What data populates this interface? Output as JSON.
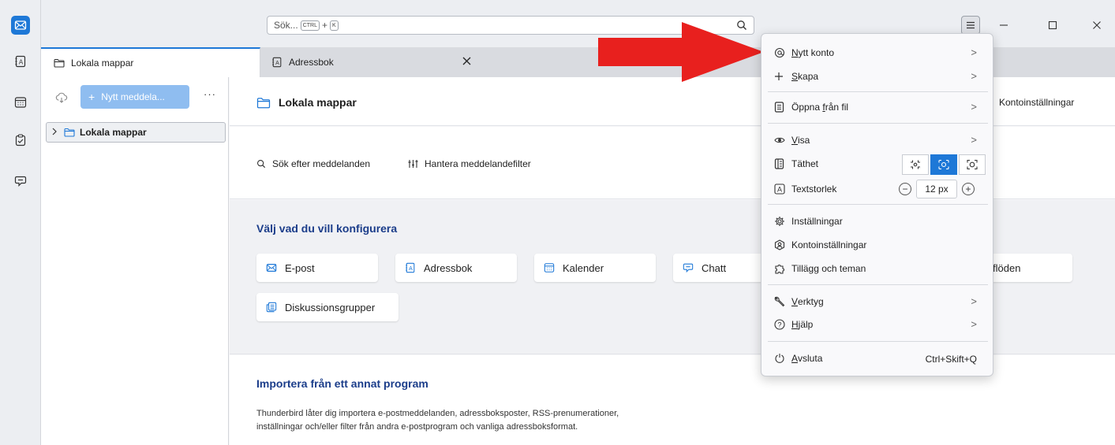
{
  "spaces": {
    "items": [
      {
        "name": "mail-icon"
      },
      {
        "name": "address-book-icon"
      },
      {
        "name": "calendar-icon"
      },
      {
        "name": "tasks-icon"
      },
      {
        "name": "chat-icon"
      }
    ]
  },
  "titlebar": {
    "search_placeholder": "Sök...",
    "search_kbd1": "CTRL",
    "search_plus": "+",
    "search_kbd2": "K"
  },
  "tabs": [
    {
      "label": "Lokala mappar",
      "active": true
    },
    {
      "label": "Adressbok",
      "active": false
    }
  ],
  "folderpane": {
    "new_message_label": "Nytt meddela...",
    "more_label": "···",
    "folders": [
      {
        "label": "Lokala mappar"
      }
    ]
  },
  "main": {
    "title": "Lokala mappar",
    "account_settings": "Kontoinställningar",
    "actions": [
      {
        "label": "Sök efter meddelanden"
      },
      {
        "label": "Hantera meddelandefilter"
      }
    ],
    "setup_title": "Välj vad du vill konfigurera",
    "setup_buttons": [
      {
        "label": "E-post"
      },
      {
        "label": "Adressbok"
      },
      {
        "label": "Kalender"
      },
      {
        "label": "Chatt"
      },
      {
        "label": "S-flöden"
      },
      {
        "label": "Diskussionsgrupper"
      }
    ],
    "import_title": "Importera från ett annat program",
    "import_desc_line1": "Thunderbird låter dig importera e-postmeddelanden, adressboksposter, RSS-prenumerationer,",
    "import_desc_line2": "inställningar och/eller filter från andra e-postprogram och vanliga adressboksformat."
  },
  "appmenu": {
    "new_account": {
      "accel": "N",
      "rest": "ytt konto"
    },
    "create": {
      "accel": "S",
      "rest": "kapa"
    },
    "open_file": {
      "pre": "Öppna ",
      "accel": "f",
      "rest": "rån fil"
    },
    "view": {
      "accel": "V",
      "rest": "isa"
    },
    "density": "Täthet",
    "font_size": "Textstorlek",
    "font_size_value": "12 px",
    "font_minus": "−",
    "font_plus": "+",
    "settings": "Inställningar",
    "account_settings": "Kontoinställningar",
    "addons": "Tillägg och teman",
    "tools": {
      "accel": "V",
      "rest": "erktyg"
    },
    "help": {
      "accel": "H",
      "rest": "jälp"
    },
    "quit": {
      "accel": "A",
      "rest": "vsluta"
    },
    "quit_shortcut": "Ctrl+Skift+Q",
    "chevron": ">"
  },
  "colors": {
    "accent": "#1e78d7",
    "annotation_arrow": "#e8201e",
    "section_title": "#1b3d8a"
  }
}
